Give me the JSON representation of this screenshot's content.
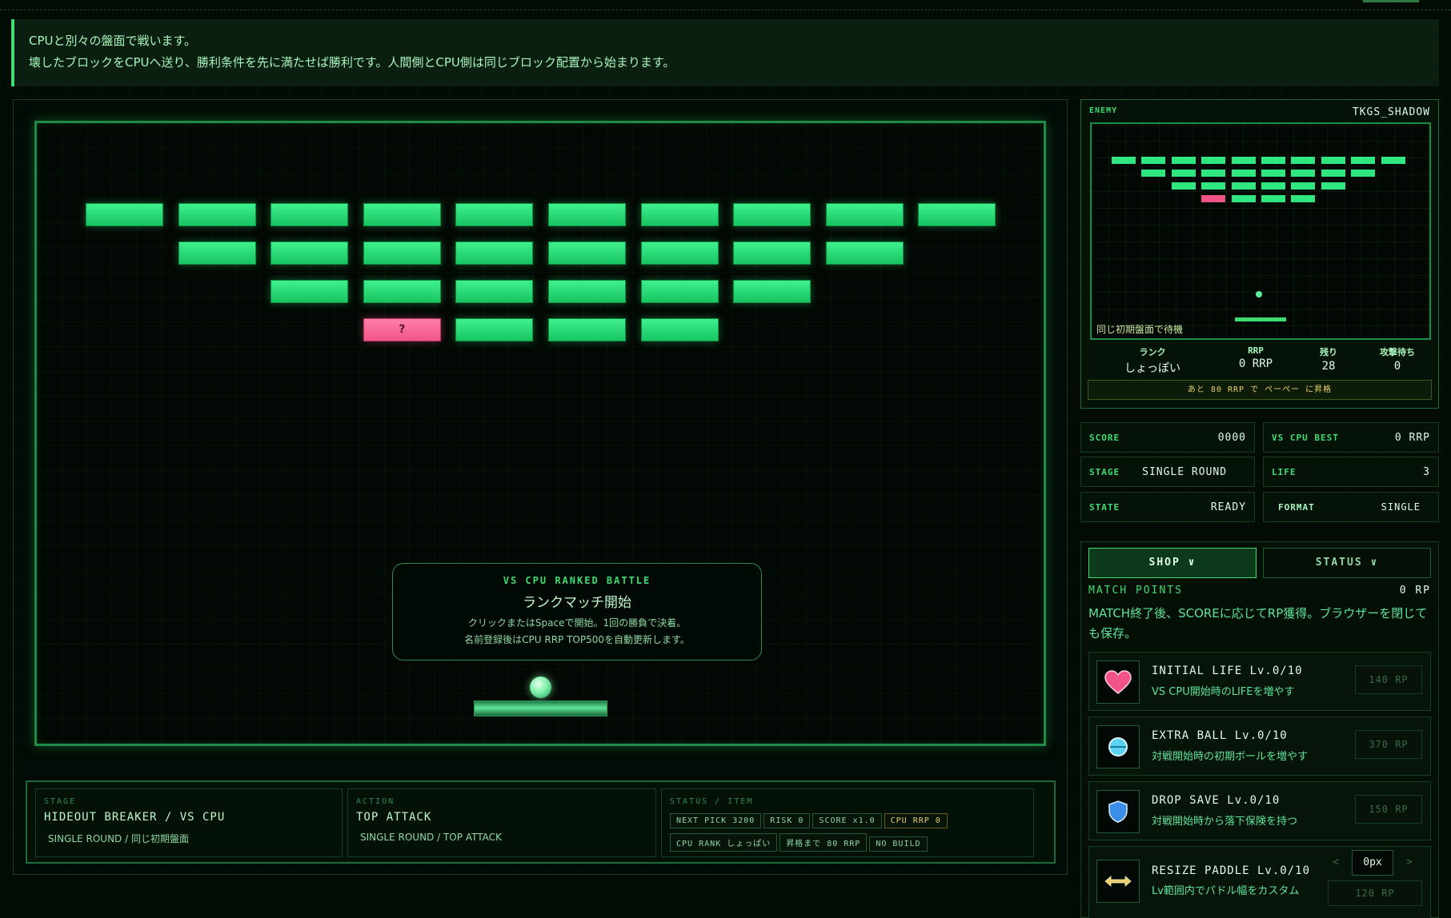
{
  "banner": {
    "line1": "CPUと別々の盤面で戦います。",
    "line2": "壊したブロックをCPUへ送り、勝利条件を先に満たせば勝利です。人間側とCPU側は同じブロック配置から始まります。"
  },
  "board": {
    "item_glyph": "?",
    "modal": {
      "kicker": "VS CPU RANKED BATTLE",
      "title": "ランクマッチ開始",
      "line1": "クリックまたはSpaceで開始。1回の勝負で決着。",
      "line2": "名前登録後はCPU RRP TOP500を自動更新します。"
    }
  },
  "hud": {
    "stage": {
      "kicker": "STAGE",
      "main": "HIDEOUT BREAKER / VS CPU",
      "sub": "SINGLE ROUND / 同じ初期盤面"
    },
    "action": {
      "kicker": "ACTION",
      "main": "TOP ATTACK",
      "sub": "SINGLE ROUND / TOP ATTACK"
    },
    "status": {
      "kicker": "STATUS / ITEM",
      "chips": [
        "NEXT PICK 3200",
        "RISK 0",
        "SCORE x1.0",
        "CPU RRP 0",
        "CPU RANK しょっぱい",
        "昇格まで 80 RRP",
        "NO BUILD"
      ]
    }
  },
  "enemy": {
    "label": "ENEMY",
    "name": "TKGS_SHADOW",
    "caption": "同じ初期盤面で待機",
    "stats": [
      {
        "label": "ランク",
        "value": "しょっぽい"
      },
      {
        "label": "RRP",
        "value": "0 RRP"
      },
      {
        "label": "残り",
        "value": "28"
      },
      {
        "label": "攻撃待ち",
        "value": "0"
      }
    ],
    "promo": "あと 80 RRP で ぺーぺー に昇格"
  },
  "stats": {
    "score": {
      "label": "SCORE",
      "value": "0000"
    },
    "vs_best": {
      "label": "VS CPU BEST",
      "value": "0 RRP"
    },
    "stage": {
      "label": "STAGE",
      "value": "SINGLE ROUND"
    },
    "life": {
      "label": "LIFE",
      "value": "3"
    },
    "state": {
      "label": "STATE",
      "value": "READY"
    },
    "format": {
      "label": "FORMAT",
      "value": "SINGLE"
    }
  },
  "shop": {
    "tabs": [
      "SHOP ∨",
      "STATUS ∨"
    ],
    "points_label": "MATCH POINTS",
    "points_value": "0 RP",
    "description": "MATCH終了後、SCOREに応じてRP獲得。ブラウザーを閉じても保存。",
    "items": [
      {
        "icon": "heart-icon",
        "title": "INITIAL LIFE Lv.0/10",
        "desc": "VS CPU開始時のLIFEを増やす",
        "price": "140 RP"
      },
      {
        "icon": "ball-icon",
        "title": "EXTRA BALL Lv.0/10",
        "desc": "対戦開始時の初期ボールを増やす",
        "price": "370 RP"
      },
      {
        "icon": "shield-icon",
        "title": "DROP SAVE Lv.0/10",
        "desc": "対戦開始時から落下保険を持つ",
        "price": "150 RP"
      },
      {
        "icon": "resize-arrows-icon",
        "title": "RESIZE PADDLE Lv.0/10",
        "desc": "Lv範囲内でパドル幅をカスタム",
        "price": "120 RP"
      }
    ],
    "stepper": {
      "dec": "<",
      "value": "0px",
      "inc": ">"
    }
  },
  "colors": {
    "brick": "#2fe67f",
    "item_brick": "#f25489",
    "accent": "#3fdc72",
    "gold": "#e6cf6a"
  }
}
